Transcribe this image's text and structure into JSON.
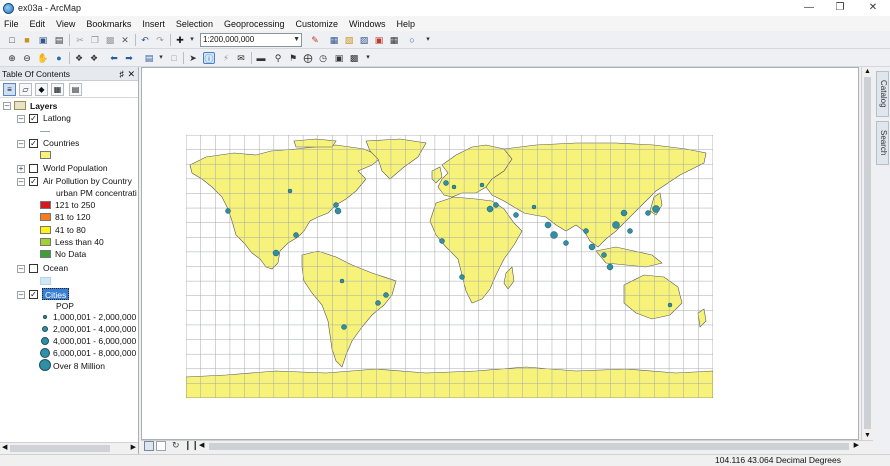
{
  "window": {
    "title": "ex03a - ArcMap"
  },
  "menu": [
    "File",
    "Edit",
    "View",
    "Bookmarks",
    "Insert",
    "Selection",
    "Geoprocessing",
    "Customize",
    "Windows",
    "Help"
  ],
  "toolbar": {
    "scale": "1:200,000,000"
  },
  "toc": {
    "title": "Table Of Contents",
    "root": "Layers",
    "layers": {
      "latlong": "Latlong",
      "countries": "Countries",
      "world_population": "World Population",
      "air_pollution": "Air Pollution by Country",
      "field": "urban PM concentrati",
      "pm_classes": [
        {
          "label": "121 to 250",
          "color": "#d7191c"
        },
        {
          "label": "81 to 120",
          "color": "#f57c1f"
        },
        {
          "label": "41 to 80",
          "color": "#fff21a"
        },
        {
          "label": "Less than 40",
          "color": "#9fd034"
        },
        {
          "label": "No Data",
          "color": "#3e9e38"
        }
      ],
      "ocean": "Ocean",
      "cities": "Cities",
      "cities_field": "POP",
      "pop_classes": [
        "1,000,001 - 2,000,000",
        "2,000,001 - 4,000,000",
        "4,000,001 - 6,000,000",
        "6,000,001 - 8,000,000",
        "Over 8 Million"
      ]
    }
  },
  "colors": {
    "land": "#f7f37a",
    "ocean_swatch": "#cfe8f7",
    "city": "#2f8fa5",
    "selection": "#3b7fd4"
  },
  "side_tabs": [
    "Catalog",
    "Search"
  ],
  "status": {
    "coords": "104.116  43.064 Decimal Degrees"
  }
}
